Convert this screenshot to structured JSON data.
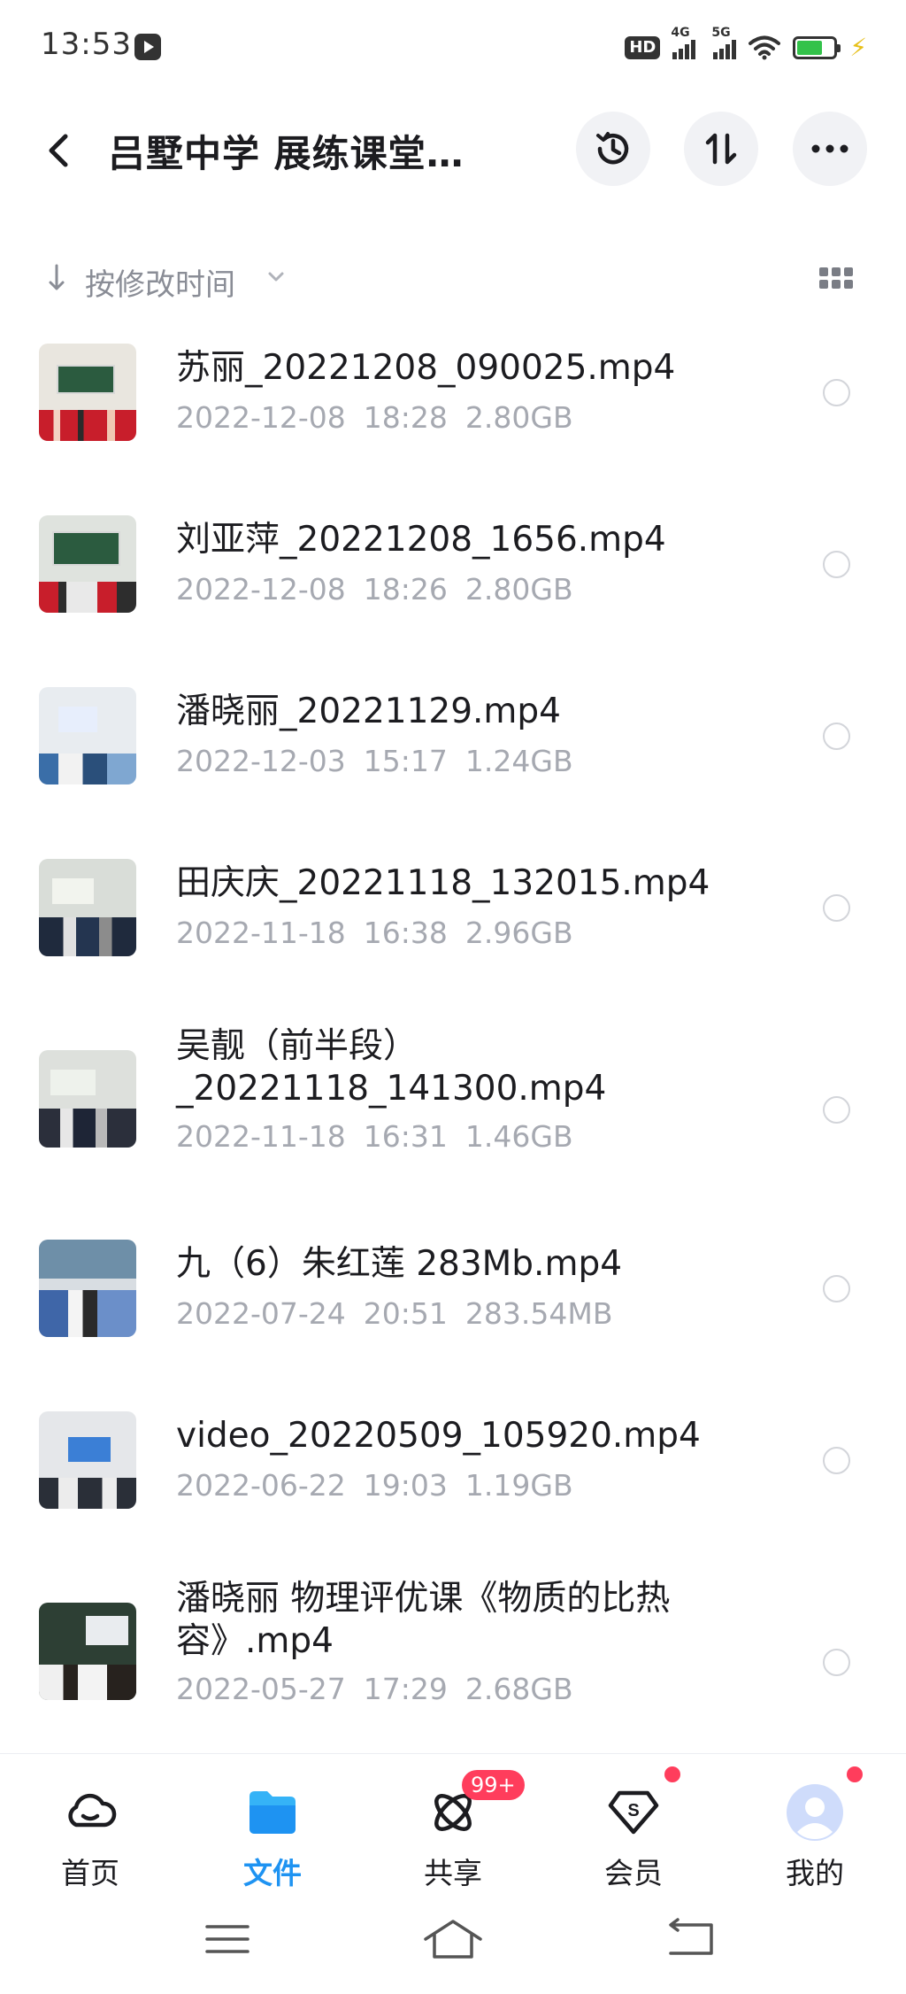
{
  "status_bar": {
    "time": "13:53",
    "hd_label": "HD",
    "net1": "4G",
    "net2": "5G",
    "battery_level": 0.7
  },
  "header": {
    "title": "吕墅中学 展练课堂…"
  },
  "sort": {
    "label": "按修改时间"
  },
  "files": [
    {
      "name": "苏丽_20221208_090025.mp4",
      "date": "2022-12-08",
      "time": "18:28",
      "size": "2.80GB"
    },
    {
      "name": "刘亚萍_20221208_1656.mp4",
      "date": "2022-12-08",
      "time": "18:26",
      "size": "2.80GB"
    },
    {
      "name": "潘晓丽_20221129.mp4",
      "date": "2022-12-03",
      "time": "15:17",
      "size": "1.24GB"
    },
    {
      "name": "田庆庆_20221118_132015.mp4",
      "date": "2022-11-18",
      "time": "16:38",
      "size": "2.96GB"
    },
    {
      "name_line1": "吴靓（前半段）",
      "name_line2": "_20221118_141300.mp4",
      "date": "2022-11-18",
      "time": "16:31",
      "size": "1.46GB"
    },
    {
      "name": "九（6）朱红莲 283Mb.mp4",
      "date": "2022-07-24",
      "time": "20:51",
      "size": "283.54MB"
    },
    {
      "name": "video_20220509_105920.mp4",
      "date": "2022-06-22",
      "time": "19:03",
      "size": "1.19GB"
    },
    {
      "name_line1": "潘晓丽 物理评优课《物质的比热",
      "name_line2": "容》.mp4",
      "date": "2022-05-27",
      "time": "17:29",
      "size": "2.68GB"
    }
  ],
  "nav": {
    "home": "首页",
    "files": "文件",
    "share": "共享",
    "share_badge": "99+",
    "vip": "会员",
    "mine": "我的",
    "active_color": "#1e93f2",
    "badge_color": "#ff3d5c"
  }
}
